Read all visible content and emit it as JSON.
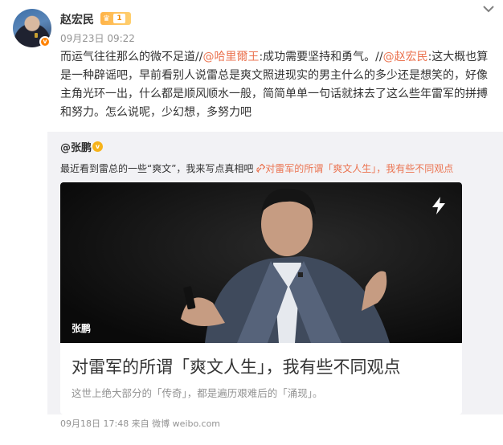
{
  "post": {
    "author": "赵宏民",
    "level": "1",
    "timestamp": "09月23日 09:22",
    "text": {
      "p1": "而运气往往那么的微不足道//",
      "mention1": "@哈里爾王",
      "p2": ":成功需要坚持和勇气。//",
      "mention2": "@赵宏民",
      "p3": ":这大概也算是一种辟谣吧，早前看别人说雷总是爽文照进现实的男主什么的多少还是想笑的，好像主角光环一出，什么都是顺风顺水一般，简简单单一句话就抹去了这么些年雷军的拼搏和努力。怎么说呢，少幻想，多努力吧"
    }
  },
  "repost": {
    "author": "@张鹏",
    "text": "最近看到雷总的一些“爽文”，我来写点真相吧",
    "link_text": "对雷军的所谓「爽文人生」，我有些不同观点",
    "card": {
      "image_caption": "张鹏",
      "title": "对雷军的所谓「爽文人生」，我有些不同观点",
      "description": "这世上绝大部分的「传奇」，都是遍历艰难后的「涌现」。"
    },
    "meta": "09月18日 17:48 来自 微博 weibo.com"
  },
  "colors": {
    "mention": "#eb7350",
    "meta": "#939393",
    "repost_bg": "#f2f2f5"
  },
  "icons": {
    "dropdown": "chevron-down-icon",
    "verified": "verified-badge-icon",
    "bolt": "lightning-icon",
    "link": "link-icon"
  }
}
